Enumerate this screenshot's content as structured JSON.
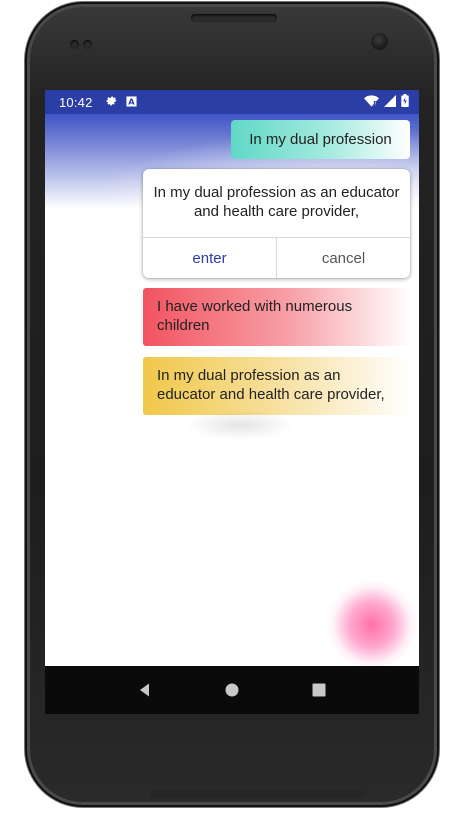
{
  "status_bar": {
    "time": "10:42",
    "icons_left": [
      "gear-icon",
      "a-badge-icon"
    ],
    "icons_right": [
      "wifi-icon",
      "signal-icon",
      "battery-icon"
    ],
    "color": "#2b3ea6"
  },
  "input_chip": {
    "text": "In my dual profession"
  },
  "dialog": {
    "text": "In my dual profession as an educator and health care provider,",
    "enter_label": "enter",
    "cancel_label": "cancel"
  },
  "cards": [
    {
      "text": "I have worked with numerous children",
      "color": "#f25360"
    },
    {
      "text": "In my dual profession as an educator and health care provider,",
      "color": "#f0c84a"
    }
  ],
  "nav_bar": {
    "buttons": [
      "back-icon",
      "home-icon",
      "recents-icon"
    ]
  },
  "colors": {
    "accent": "#2b3ea6",
    "teal": "#61d8c6",
    "pink_fab": "#ff6aa5"
  }
}
